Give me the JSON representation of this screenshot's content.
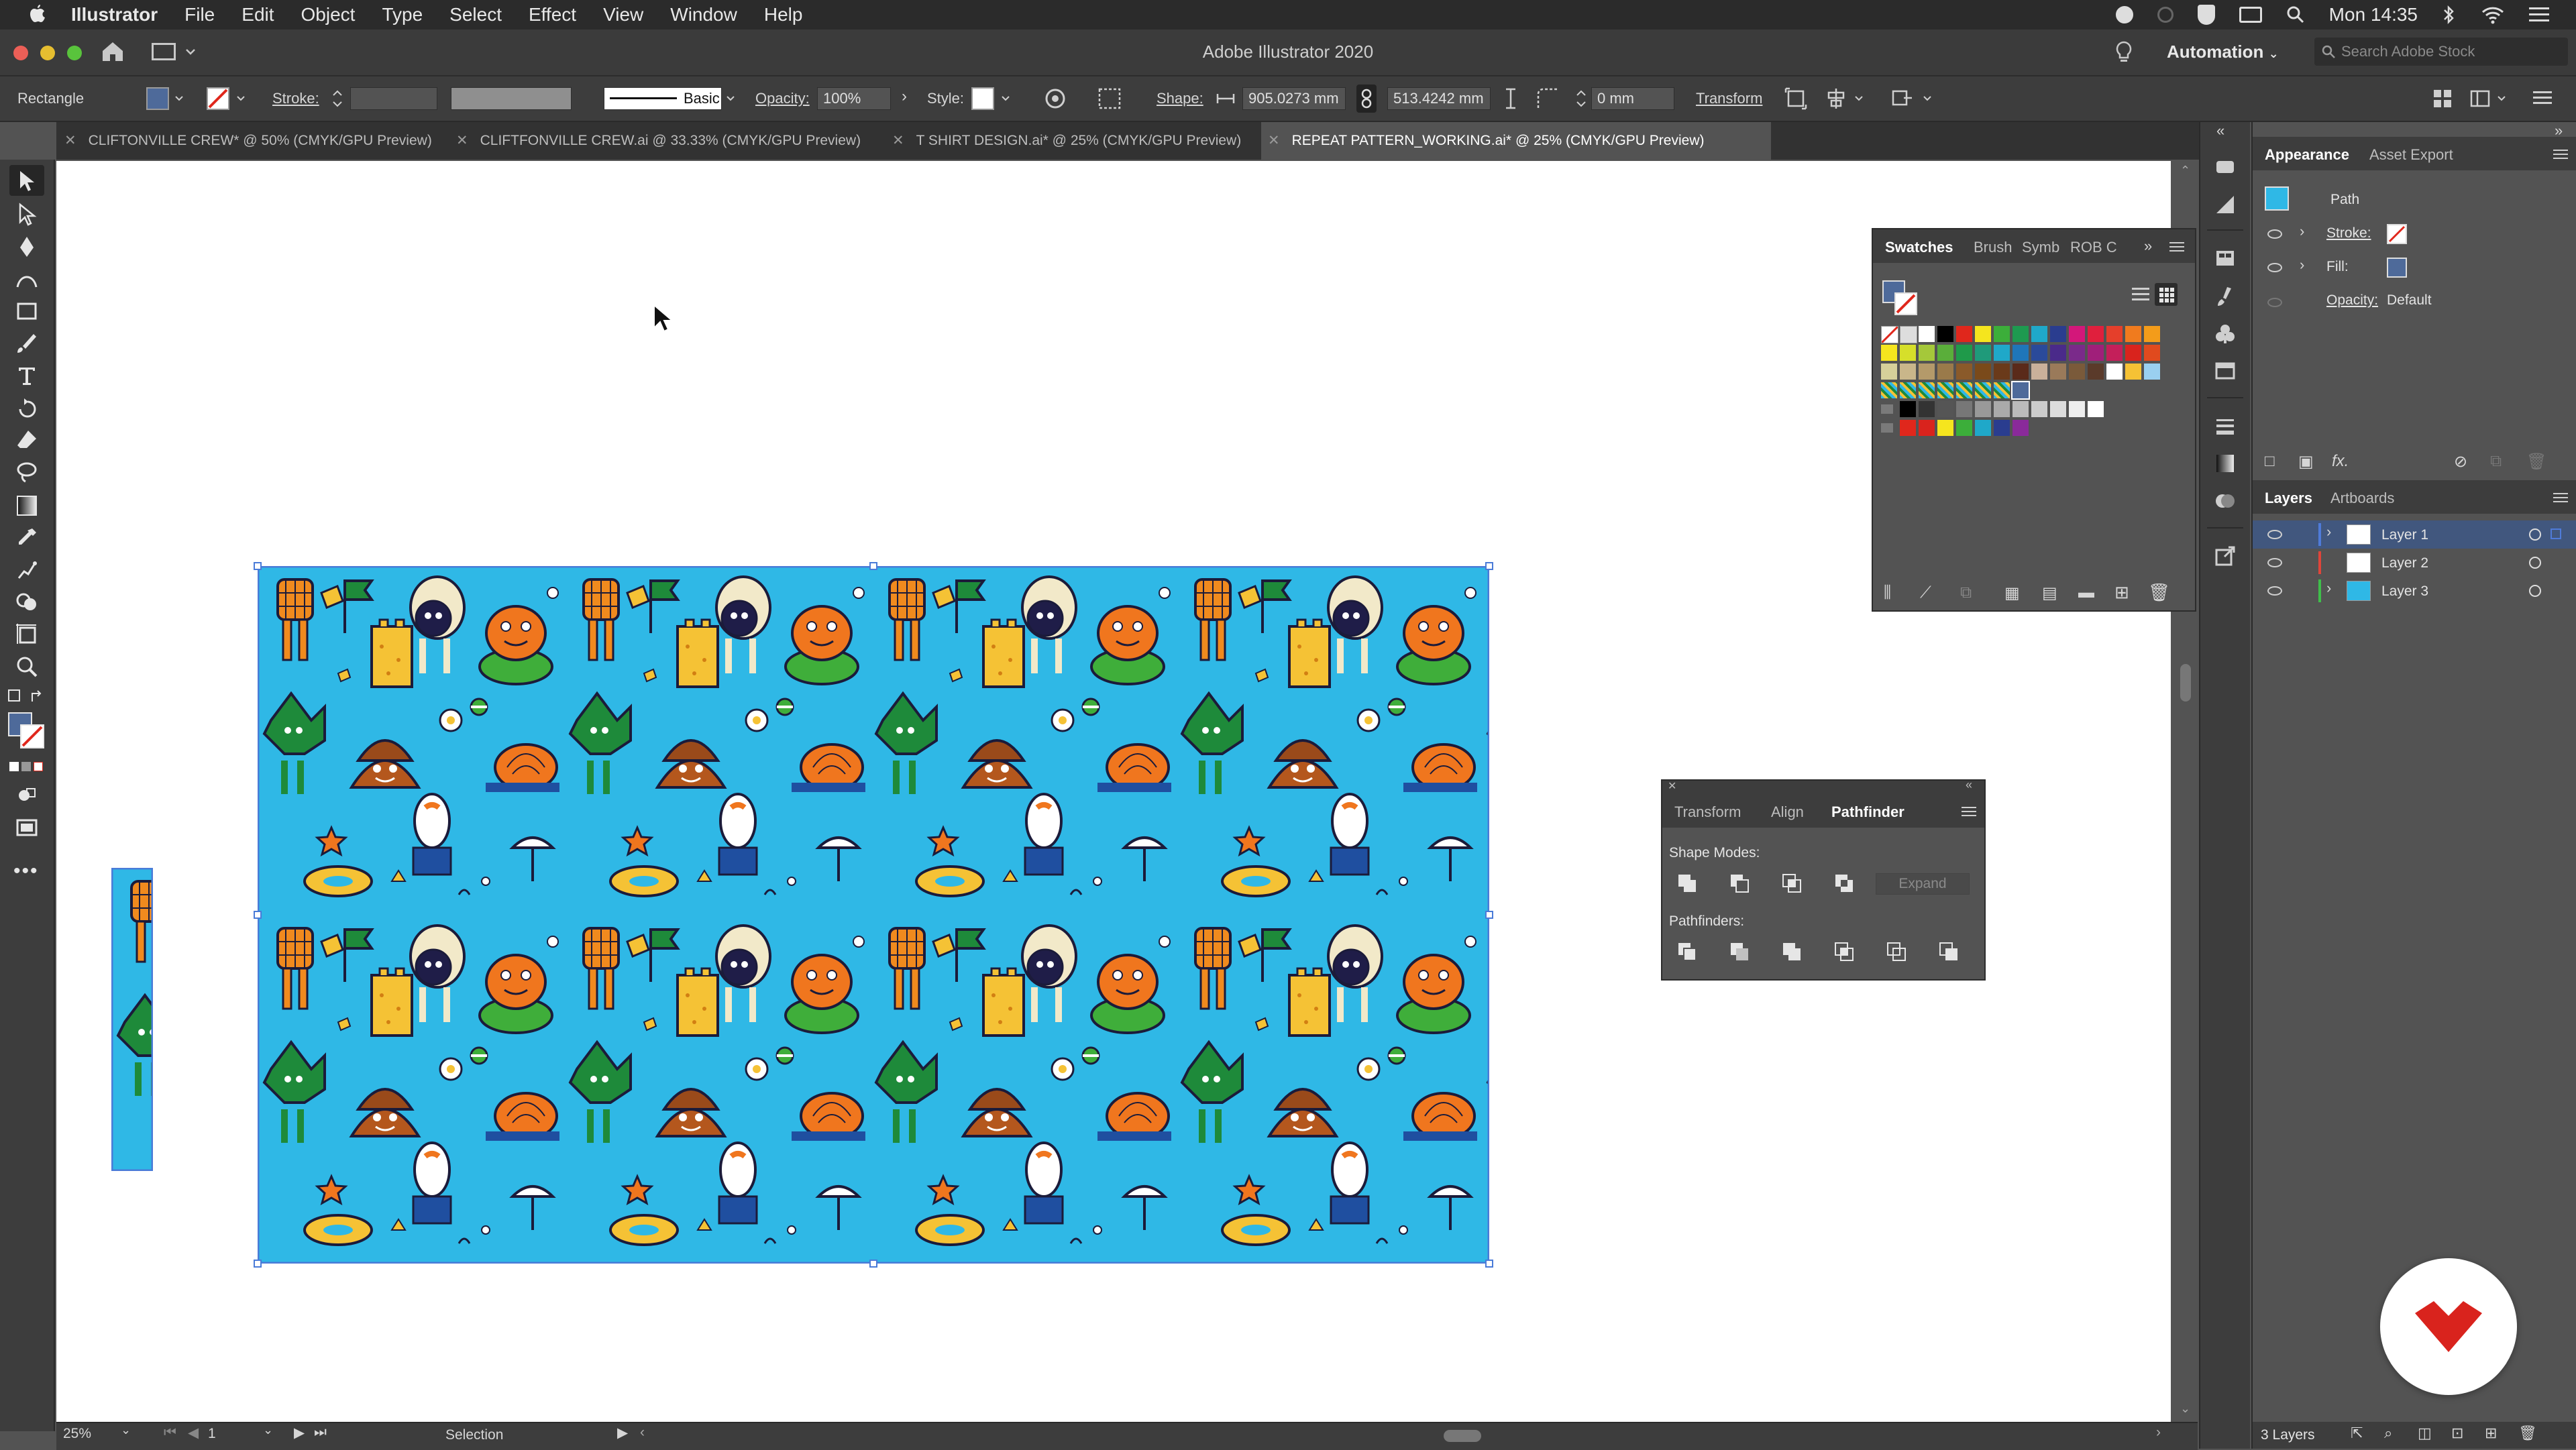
{
  "menubar": {
    "app_name": "Illustrator",
    "items": [
      "File",
      "Edit",
      "Object",
      "Type",
      "Select",
      "Effect",
      "View",
      "Window",
      "Help"
    ],
    "clock": "Mon 14:35"
  },
  "window": {
    "title": "Adobe Illustrator 2020",
    "workspace": "Automation",
    "search_placeholder": "Search Adobe Stock"
  },
  "controlbar": {
    "object_type": "Rectangle",
    "stroke_label": "Stroke:",
    "brush_label": "Basic",
    "opacity_label": "Opacity:",
    "opacity_value": "100%",
    "style_label": "Style:",
    "shape_label": "Shape:",
    "width_value": "905.0273 mm",
    "height_value": "513.4242 mm",
    "corner_value": "0 mm",
    "transform_label": "Transform"
  },
  "tabs": [
    {
      "label": "CLIFTONVILLE CREW* @ 50% (CMYK/GPU Preview)",
      "active": false
    },
    {
      "label": "CLIFTFONVILLE CREW.ai @ 33.33% (CMYK/GPU Preview)",
      "active": false
    },
    {
      "label": "T SHIRT DESIGN.ai* @ 25% (CMYK/GPU Preview)",
      "active": false
    },
    {
      "label": "REPEAT PATTERN_WORKING.ai* @ 25% (CMYK/GPU Preview)",
      "active": true
    }
  ],
  "swatches_panel": {
    "tabs": [
      "Swatches",
      "Brush",
      "Symb",
      "ROB C"
    ]
  },
  "pathfinder_panel": {
    "tabs": [
      "Transform",
      "Align",
      "Pathfinder"
    ],
    "shape_modes_label": "Shape Modes:",
    "expand_label": "Expand",
    "pathfinders_label": "Pathfinders:"
  },
  "appearance_panel": {
    "tabs": [
      "Appearance",
      "Asset Export"
    ],
    "object_label": "Path",
    "stroke_label": "Stroke:",
    "fill_label": "Fill:",
    "opacity_label": "Opacity:",
    "opacity_value": "Default"
  },
  "layers_panel": {
    "tabs": [
      "Layers",
      "Artboards"
    ],
    "layers": [
      {
        "name": "Layer 1",
        "color": "#4f7bd9"
      },
      {
        "name": "Layer 2",
        "color": "#e0453a"
      },
      {
        "name": "Layer 3",
        "color": "#3fbf4a"
      }
    ],
    "count_label": "3 Layers"
  },
  "statusbar": {
    "zoom": "25%",
    "artboard": "1",
    "tool": "Selection"
  },
  "colors": {
    "pattern_background": "#2fb8e6",
    "selection": "#4a7bd8",
    "brand_red": "#d9231d"
  }
}
